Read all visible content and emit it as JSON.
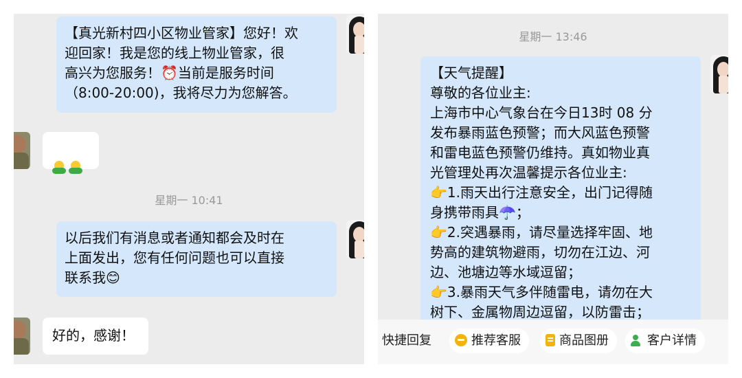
{
  "left_chat": {
    "messages": [
      {
        "sender": "property-manager",
        "text": "【真光新村四小区物业管家】您好！欢\n迎回家！我是您的线上物业管家，很\n高兴为您服务！⏰当前是服务时间\n（8:00-20:00)，我将尽力为您解答。"
      },
      {
        "sender": "resident",
        "emoji": "hugging-face-emoji",
        "text": ""
      },
      {
        "timestamp": "星期一 10:41"
      },
      {
        "sender": "property-manager",
        "text": "以后我们有消息或者通知都会及时在\n上面发出，您有任何问题也可以直接\n联系我😊"
      },
      {
        "sender": "resident",
        "text": "好的，感谢！"
      }
    ]
  },
  "right_chat": {
    "timestamp": "星期一 13:46",
    "message": {
      "sender": "property-manager",
      "text": "【天气提醒】\n尊敬的各位业主:\n上海市中心气象台在今日13时 08 分\n发布暴雨蓝色预警；而大风蓝色预警\n和雷电蓝色预警仍维持。真如物业真\n光管理处再次温馨提示各位业主:\n👉1.雨天出行注意安全，出门记得随\n身携带雨具☂️；\n👉2.突遇暴雨，请尽量选择牢固、地\n势高的建筑物避雨，切勿在江边、河\n边、池塘边等水域逗留；\n👉3.暴雨天气多伴随雷电，请勿在大\n树下、金属物周边逗留，以防雷击；"
    },
    "quick_bar": {
      "quick_reply_label": "快捷回复",
      "items": [
        {
          "label": "推荐客服",
          "icon": "chat-icon"
        },
        {
          "label": "商品图册",
          "icon": "catalog-icon"
        },
        {
          "label": "客户详情",
          "icon": "user-icon"
        }
      ]
    }
  },
  "colors": {
    "outgoing_bubble": "#d4e7fb",
    "incoming_bubble": "#ffffff",
    "chat_background": "#ececec"
  }
}
